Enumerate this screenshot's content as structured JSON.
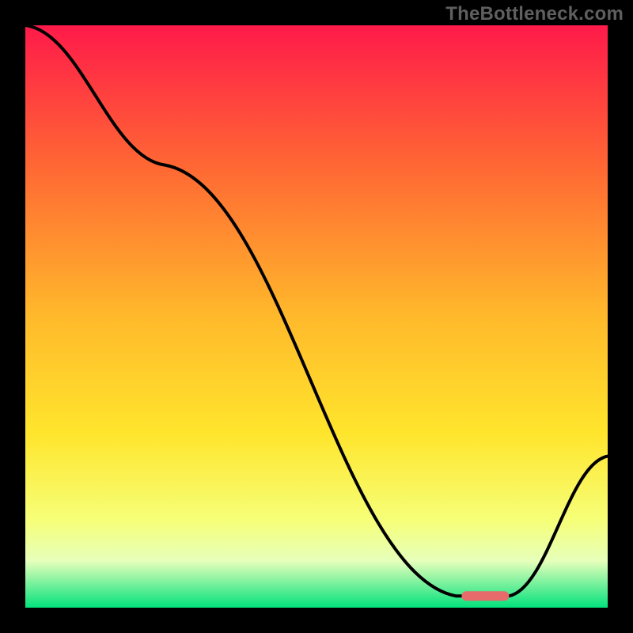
{
  "watermark": "TheBottleneck.com",
  "chart_data": {
    "type": "line",
    "title": "",
    "xlabel": "",
    "ylabel": "",
    "xlim": [
      0,
      100
    ],
    "ylim": [
      0,
      100
    ],
    "background_gradient": {
      "stops": [
        {
          "pct": 0,
          "color": "#ff1a4a"
        },
        {
          "pct": 25,
          "color": "#ff6a33"
        },
        {
          "pct": 50,
          "color": "#ffb92b"
        },
        {
          "pct": 70,
          "color": "#ffe52c"
        },
        {
          "pct": 85,
          "color": "#f6ff78"
        },
        {
          "pct": 92,
          "color": "#e6ffbb"
        },
        {
          "pct": 100,
          "color": "#03e27c"
        }
      ]
    },
    "x": [
      0,
      24,
      74,
      83,
      100
    ],
    "values": [
      100,
      76,
      2,
      2,
      26
    ],
    "marker": {
      "x": 79,
      "y": 2,
      "color": "#e86b6b"
    }
  }
}
